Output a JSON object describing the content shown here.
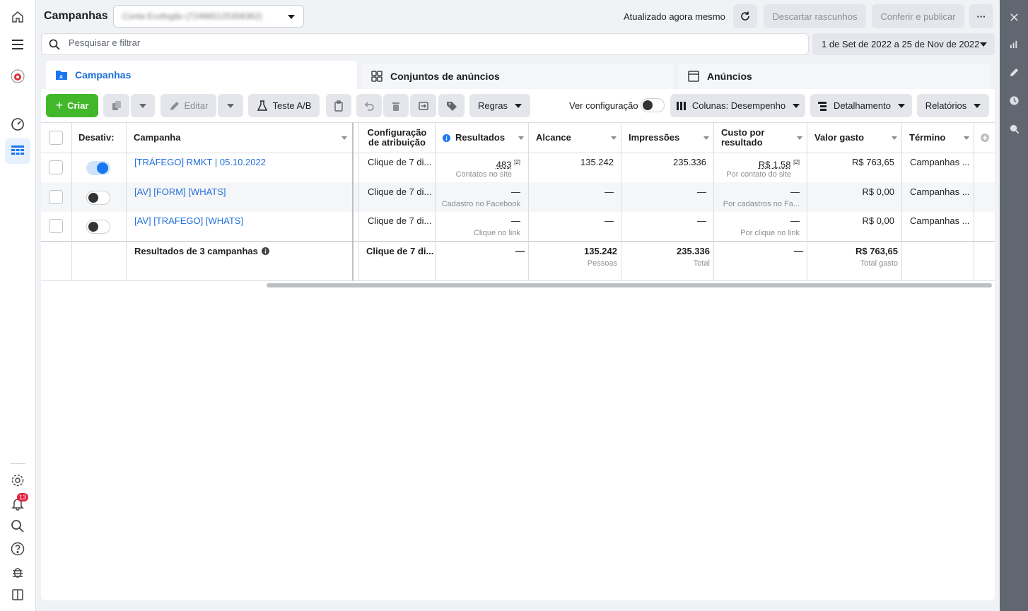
{
  "header": {
    "title": "Campanhas",
    "account": "Conta Ecofogão (724965125308362)",
    "updated": "Atualizado agora mesmo",
    "discard": "Descartar rascunhos",
    "review": "Conferir e publicar",
    "more": "···"
  },
  "search": {
    "placeholder": "Pesquisar e filtrar"
  },
  "daterange": "1 de Set de 2022 a 25 de Nov de 2022",
  "tabs": [
    "Campanhas",
    "Conjuntos de anúncios",
    "Anúncios"
  ],
  "toolbar": {
    "create": "Criar",
    "edit": "Editar",
    "ab_test": "Teste A/B",
    "rules": "Regras",
    "view_setup": "Ver configuração",
    "columns": "Colunas: Desempenho",
    "breakdown": "Detalhamento",
    "reports": "Relatórios"
  },
  "columns": {
    "off": "Desativ:",
    "campaign": "Campanha",
    "attribution_1": "Configuração",
    "attribution_2": "de atribuição",
    "results": "Resultados",
    "reach": "Alcance",
    "impressions": "Impressões",
    "cpr_1": "Custo por",
    "cpr_2": "resultado",
    "spent": "Valor gasto",
    "end": "Término"
  },
  "rows": [
    {
      "on": true,
      "name": "[TRÁFEGO] RMKT | 05.10.2022",
      "attribution": "Clique de 7 di...",
      "results": "483",
      "results_note": "[2]",
      "results_sub": "Contatos no site",
      "reach": "135.242",
      "impressions": "235.336",
      "cpr": "R$ 1,58",
      "cpr_note": "[2]",
      "cpr_sub": "Por contato do site",
      "spent": "R$ 763,65",
      "end": "Campanhas ..."
    },
    {
      "on": false,
      "name": "[AV] [FORM] [WHATS]",
      "attribution": "Clique de 7 di...",
      "results": "—",
      "results_sub": "Cadastro no Facebook",
      "reach": "—",
      "impressions": "—",
      "cpr": "—",
      "cpr_sub": "Por cadastros no Fa...",
      "spent": "R$ 0,00",
      "end": "Campanhas ..."
    },
    {
      "on": false,
      "name": "[AV] [TRAFEGO] [WHATS]",
      "attribution": "Clique de 7 di...",
      "results": "—",
      "results_sub": "Clique no link",
      "reach": "—",
      "impressions": "—",
      "cpr": "—",
      "cpr_sub": "Por clique no link",
      "spent": "R$ 0,00",
      "end": "Campanhas ..."
    }
  ],
  "totals": {
    "label": "Resultados de 3 campanhas",
    "attribution": "Clique de 7 di...",
    "results": "—",
    "reach": "135.242",
    "reach_sub": "Pessoas",
    "impressions": "235.336",
    "impressions_sub": "Total",
    "cpr": "—",
    "spent": "R$ 763,65",
    "spent_sub": "Total gasto"
  },
  "notifications_count": "13",
  "colors": {
    "accent": "#1877f2",
    "create": "#42b72a",
    "link": "#216fdb"
  }
}
